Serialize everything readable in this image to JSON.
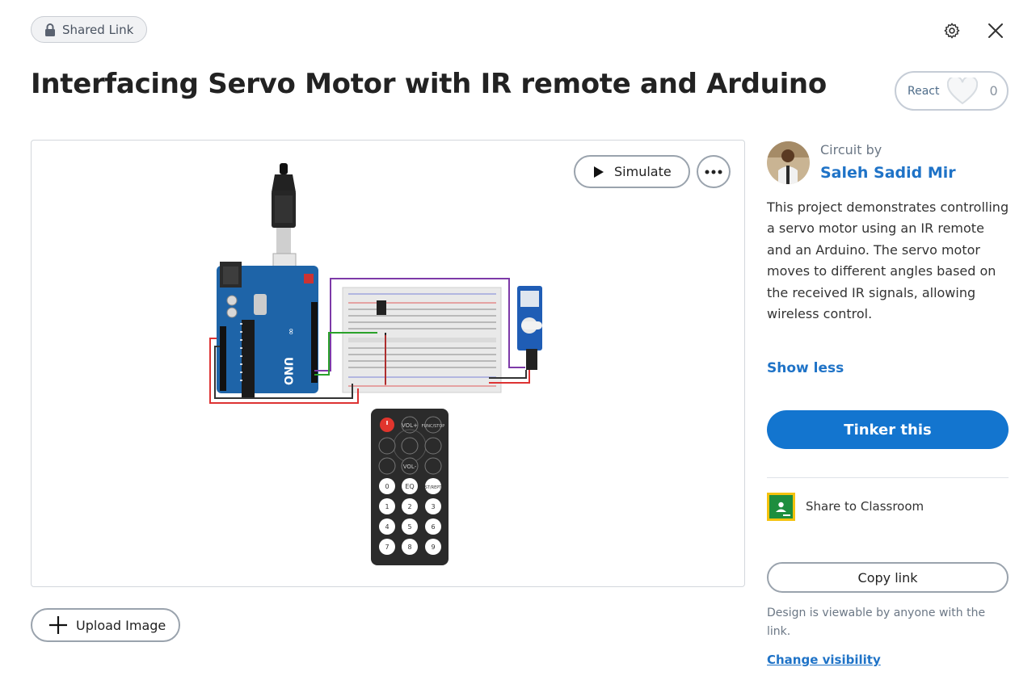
{
  "header": {
    "shared_label": "Shared Link",
    "title": "Interfacing Servo Motor with IR remote and Arduino",
    "react_label": "React",
    "react_count": "0",
    "icons": {
      "lock": "lock-icon",
      "settings": "gear-icon",
      "close": "close-icon",
      "heart": "heart-icon"
    }
  },
  "viewer": {
    "simulate_label": "Simulate",
    "upload_label": "Upload Image",
    "components": [
      "Arduino UNO",
      "Breadboard",
      "IR receiver",
      "Micro servo",
      "IR remote"
    ],
    "remote_buttons": [
      "VOL+",
      "FUNC/STOP",
      "VOL-",
      "EQ",
      "ST/REPT",
      "0",
      "1",
      "2",
      "3",
      "4",
      "5",
      "6",
      "7",
      "8",
      "9"
    ],
    "board_label": "UNO"
  },
  "sidebar": {
    "byline": "Circuit by",
    "author": "Saleh Sadid Mir",
    "description": "This project demonstrates controlling a servo motor using an IR remote and an Arduino. The servo motor moves to different angles based on the received IR signals, allowing wireless control.",
    "show_less": "Show less",
    "tinker_label": "Tinker this",
    "classroom_label": "Share to Classroom",
    "copy_label": "Copy link",
    "visibility_note": "Design is viewable by anyone with the link.",
    "change_visibility": "Change visibility"
  },
  "colors": {
    "accent": "#1375cf",
    "link": "#1f73c7",
    "arduino": "#1e64a8",
    "classroom": "#1e8e3e"
  }
}
